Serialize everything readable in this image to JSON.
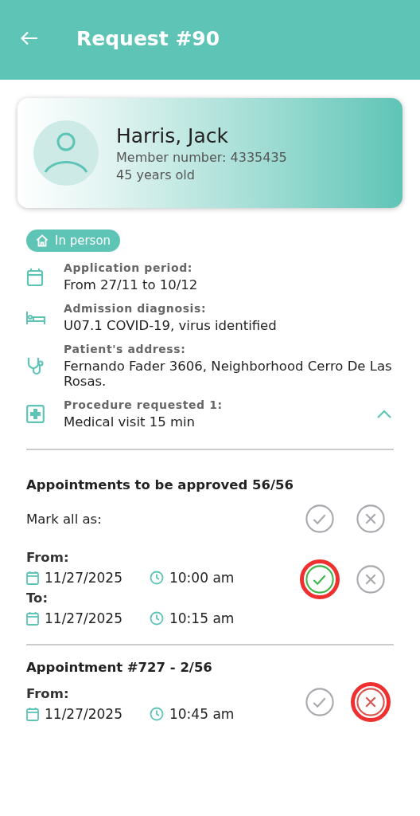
{
  "header": {
    "title": "Request #90"
  },
  "patient": {
    "name": "Harris, Jack",
    "member": "Member number: 4335435",
    "age": "45 years old"
  },
  "badge": {
    "label": "In person"
  },
  "details": [
    {
      "kind": "calendar",
      "label": "Application period:",
      "value": "From 27/11 to 10/12"
    },
    {
      "kind": "bed",
      "label": "Admission diagnosis:",
      "value": "U07.1 COVID-19, virus identified"
    },
    {
      "kind": "stethoscope",
      "label": "Patient's address:",
      "value": "Fernando Fader 3606, Neighborhood Cerro De Las Rosas."
    },
    {
      "kind": "medical",
      "label": "Procedure requested 1:",
      "value": "Medical visit 15 min",
      "expanded": true
    }
  ],
  "approvals": {
    "heading": "Appointments to be approved 56/56",
    "mark_all": "Mark all as:"
  },
  "appointments": [
    {
      "from_label": "From:",
      "from_date": "11/27/2025",
      "from_time": "10:00 am",
      "to_label": "To:",
      "to_date": "11/27/2025",
      "to_time": "10:15 am",
      "approved": true,
      "rejected": false
    },
    {
      "title": "Appointment #727 - 2/56",
      "from_label": "From:",
      "from_date": "11/27/2025",
      "from_time": "10:45 am",
      "approved": false,
      "rejected": true
    }
  ]
}
